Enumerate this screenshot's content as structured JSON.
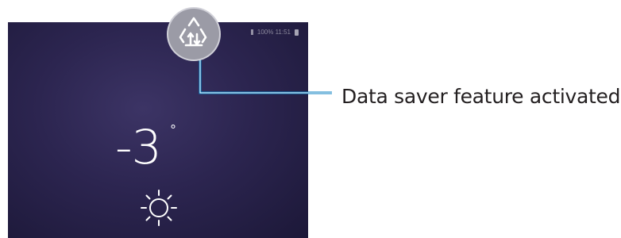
{
  "status_bar": {
    "text": "100%  11:51"
  },
  "lockscreen": {
    "temperature": "-3",
    "degree_symbol": "°",
    "weather_icon": "sun-icon"
  },
  "callout": {
    "label": "Data saver feature activated",
    "icon": "data-saver-icon",
    "line_color": "#0a7fc2"
  }
}
